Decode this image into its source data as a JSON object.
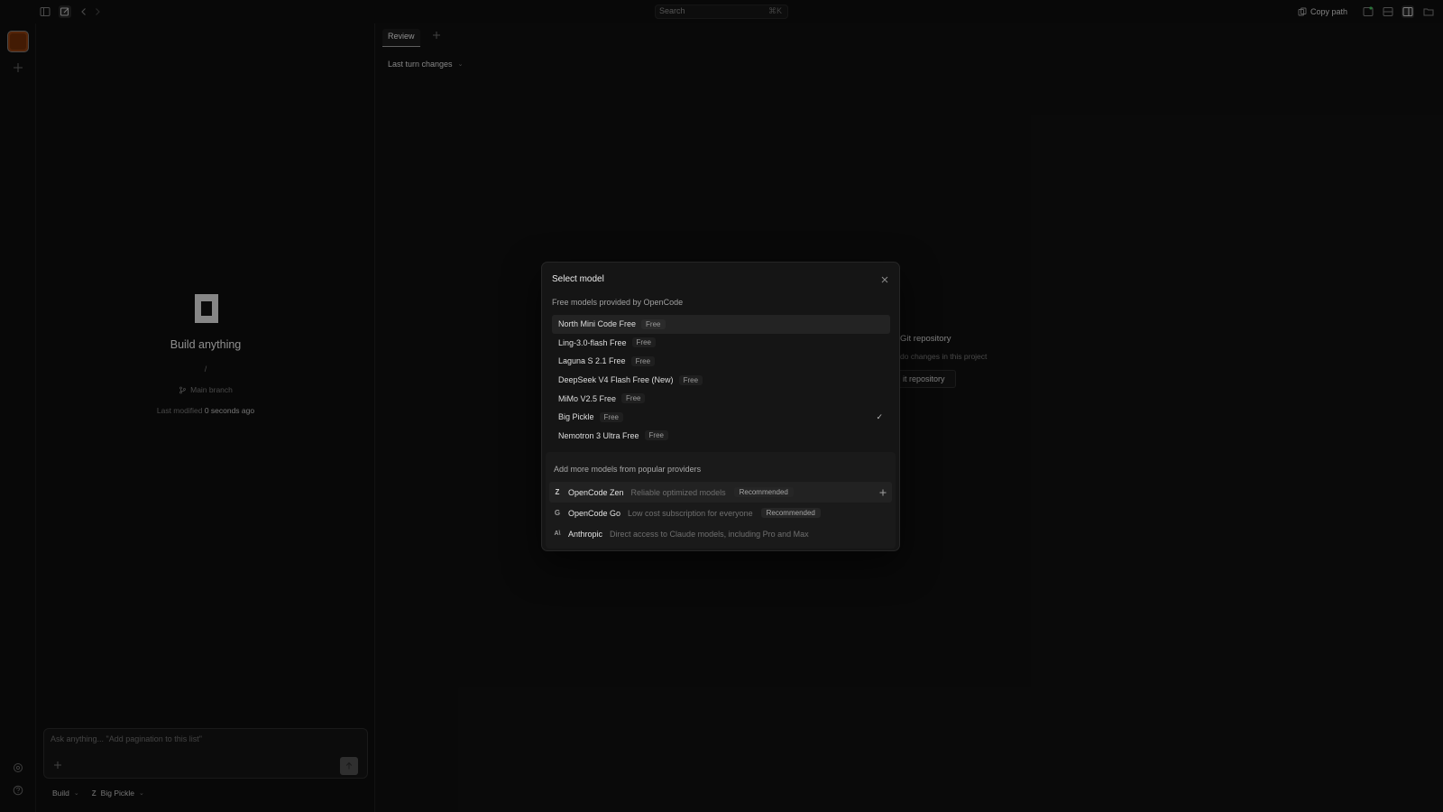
{
  "topbar": {
    "search_placeholder": "Search",
    "search_shortcut": "⌘K",
    "copy_path_label": "Copy path"
  },
  "session": {
    "title": "Build anything",
    "path": "/",
    "branch": "Main branch",
    "last_modified_label": "Last modified",
    "last_modified_value": "0 seconds ago",
    "composer_placeholder": "Ask anything... \"Add pagination to this list\"",
    "agent": "Build",
    "model": "Big Pickle"
  },
  "review": {
    "tab_label": "Review",
    "changes_filter": "Last turn changes",
    "empty_heading": "Git repository",
    "empty_subtext": "do changes in this project",
    "empty_button": "it repository"
  },
  "modal": {
    "title": "Select model",
    "free_heading": "Free models provided by OpenCode",
    "models": [
      {
        "name": "North Mini Code Free",
        "badge": "Free"
      },
      {
        "name": "Ling-3.0-flash Free",
        "badge": "Free"
      },
      {
        "name": "Laguna S 2.1 Free",
        "badge": "Free"
      },
      {
        "name": "DeepSeek V4 Flash Free (New)",
        "badge": "Free"
      },
      {
        "name": "MiMo V2.5 Free",
        "badge": "Free"
      },
      {
        "name": "Big Pickle",
        "badge": "Free",
        "selected_mark": "✓"
      },
      {
        "name": "Nemotron 3 Ultra Free",
        "badge": "Free"
      }
    ],
    "providers_heading": "Add more models from popular providers",
    "providers": [
      {
        "name": "OpenCode Zen",
        "description": "Reliable optimized models",
        "badge": "Recommended",
        "icon": "zen-icon"
      },
      {
        "name": "OpenCode Go",
        "description": "Low cost subscription for everyone",
        "badge": "Recommended",
        "icon": "go-icon"
      },
      {
        "name": "Anthropic",
        "description": "Direct access to Claude models, including Pro and Max",
        "icon": "anthropic-icon"
      }
    ]
  },
  "colors": {
    "background": "#0b0b0b",
    "modal": "#151515",
    "project_accent": "#8a3c10"
  }
}
